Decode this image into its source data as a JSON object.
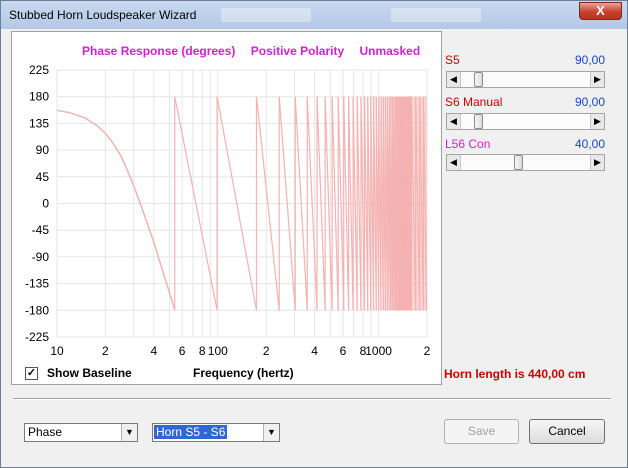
{
  "window": {
    "title": "Stubbed Horn Loudspeaker Wizard",
    "close_label": "X"
  },
  "chart_header": {
    "response": "Phase Response (degrees)",
    "polarity": "Positive Polarity",
    "mask": "Unmasked"
  },
  "chart_data": {
    "type": "line",
    "title": "Phase Response (degrees)",
    "xlabel": "Frequency (hertz)",
    "ylabel": "",
    "x_scale": "log",
    "xlim": [
      10,
      2000
    ],
    "ylim": [
      -225,
      225
    ],
    "y_ticks": [
      "225",
      "180",
      "135",
      "90",
      "45",
      "0",
      "-45",
      "-90",
      "-135",
      "-180",
      "-225"
    ],
    "x_ticks": [
      {
        "value": 10,
        "label": "10"
      },
      {
        "value": 20,
        "label": "2"
      },
      {
        "value": 40,
        "label": "4"
      },
      {
        "value": 60,
        "label": "6"
      },
      {
        "value": 80,
        "label": "8"
      },
      {
        "value": 100,
        "label": "100"
      },
      {
        "value": 200,
        "label": "2"
      },
      {
        "value": 400,
        "label": "4"
      },
      {
        "value": 600,
        "label": "6"
      },
      {
        "value": 800,
        "label": "8"
      },
      {
        "value": 1000,
        "label": "1000"
      },
      {
        "value": 2000,
        "label": "2"
      }
    ],
    "grid": true,
    "series_color": "#f4b2b2",
    "series": [
      {
        "x": [
          10,
          12,
          15,
          18,
          20,
          22,
          25,
          28,
          30,
          35,
          40,
          45,
          50,
          54
        ],
        "y": [
          157,
          153,
          144,
          130,
          118,
          104,
          80,
          50,
          30,
          -20,
          -65,
          -110,
          -150,
          -180
        ]
      }
    ],
    "wrap_points": [
      54,
      99,
      174,
      241,
      303,
      360,
      414,
      465,
      514,
      561,
      607,
      651,
      694,
      736,
      777,
      817,
      856,
      894,
      931,
      967,
      1002,
      1036,
      1069,
      1101,
      1132,
      1162,
      1191,
      1219,
      1246,
      1272,
      1297,
      1321,
      1344,
      1366,
      1387,
      1407,
      1426,
      1444,
      1461,
      1477,
      1492,
      1506,
      1519,
      1531,
      1542,
      1552,
      1561,
      1569,
      1576,
      1582,
      1587,
      1591,
      1594,
      1597,
      1700,
      1800,
      1900,
      1990
    ]
  },
  "sliders": [
    {
      "label": "S5",
      "value": "90,00",
      "position": 0.11
    },
    {
      "label": "S6  Manual",
      "value": "90,00",
      "position": 0.11
    },
    {
      "label": "L56  Con",
      "value": "40,00",
      "position": 0.44
    }
  ],
  "colors": {
    "slider_label": "#cc0000",
    "slider_label_alt": "#d41fd4",
    "slider_value": "#1a46c8"
  },
  "show_baseline": {
    "label": "Show Baseline",
    "checked": true
  },
  "freq_label": "Frequency (hertz)",
  "horn_length": "Horn length is 440,00 cm",
  "bottom": {
    "plot_select": "Phase",
    "horn_select": "Horn S5 - S6",
    "save_label": "Save",
    "cancel_label": "Cancel"
  }
}
